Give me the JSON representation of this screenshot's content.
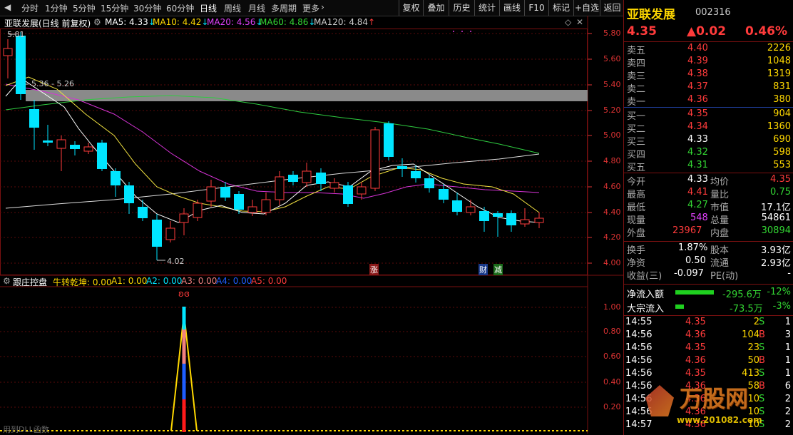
{
  "toolbar": {
    "periods": [
      "分时",
      "1分钟",
      "5分钟",
      "15分钟",
      "30分钟",
      "60分钟",
      "日线",
      "周线",
      "月线",
      "多周期",
      "更多"
    ],
    "buttons": [
      "复权",
      "叠加",
      "历史",
      "统计",
      "画线",
      "F10",
      "标记",
      "+自选",
      "返回"
    ]
  },
  "chart_header": {
    "title": "亚联发展(日线 前复权)",
    "ma5": "MA5: 4.33",
    "ma10": "MA10: 4.42",
    "ma20": "MA20: 4.56",
    "ma60": "MA60: 4.86",
    "ma120": "MA120: 4.84"
  },
  "price_axis": [
    "5.80",
    "5.60",
    "5.40",
    "5.20",
    "5.00",
    "4.80",
    "4.60",
    "4.40",
    "4.20",
    "4.00"
  ],
  "price_labels": {
    "high": "5.81",
    "low": "4.02",
    "range": "5.36 - 5.26"
  },
  "chart_marks": {
    "zhang": "涨",
    "cai": "财",
    "jian": "减"
  },
  "indicator": {
    "name": "跟庄控盘",
    "label_main": "牛转乾坤: 0.00",
    "a1": "A1: 0.00",
    "a2": "A2: 0.00",
    "a3": "A3: 0.00",
    "a4": "A4: 0.00",
    "a5": "A5: 0.00",
    "axis": [
      "1.00",
      "0.80",
      "0.60",
      "0.40",
      "0.20"
    ],
    "footer": "用到DLL函数"
  },
  "stock": {
    "name": "亚联发展",
    "code": "002316",
    "price": "4.35",
    "change": "▲0.02",
    "pct": "0.46%"
  },
  "asks": [
    {
      "label": "卖五",
      "price": "4.40",
      "vol": "2226"
    },
    {
      "label": "卖四",
      "price": "4.39",
      "vol": "1048"
    },
    {
      "label": "卖三",
      "price": "4.38",
      "vol": "1319"
    },
    {
      "label": "卖二",
      "price": "4.37",
      "vol": "831"
    },
    {
      "label": "卖一",
      "price": "4.36",
      "vol": "380"
    }
  ],
  "bids": [
    {
      "label": "买一",
      "price": "4.35",
      "vol": "904"
    },
    {
      "label": "买二",
      "price": "4.34",
      "vol": "1360"
    },
    {
      "label": "买三",
      "price": "4.33",
      "vol": "690"
    },
    {
      "label": "买四",
      "price": "4.32",
      "vol": "598"
    },
    {
      "label": "买五",
      "price": "4.31",
      "vol": "553"
    }
  ],
  "stats": [
    {
      "l1": "今开",
      "v1": "4.33",
      "l2": "均价",
      "v2": "4.35"
    },
    {
      "l1": "最高",
      "v1": "4.41",
      "l2": "量比",
      "v2": "0.75"
    },
    {
      "l1": "最低",
      "v1": "4.27",
      "l2": "市值",
      "v2": "17.1亿"
    },
    {
      "l1": "现量",
      "v1": "548",
      "l2": "总量",
      "v2": "54861"
    },
    {
      "l1": "外盘",
      "v1": "23967",
      "l2": "内盘",
      "v2": "30894"
    }
  ],
  "stats2": [
    {
      "l1": "换手",
      "v1": "1.87%",
      "l2": "股本",
      "v2": "3.93亿"
    },
    {
      "l1": "净资",
      "v1": "0.50",
      "l2": "流通",
      "v2": "2.93亿"
    },
    {
      "l1": "收益(三)",
      "v1": "-0.097",
      "l2": "PE(动)",
      "v2": "-"
    }
  ],
  "flows": [
    {
      "label": "净流入额",
      "value": "-295.6万",
      "pct": "-12%",
      "bar": 0.8
    },
    {
      "label": "大宗流入",
      "value": "-73.5万",
      "pct": "-3%",
      "bar": 0.15
    }
  ],
  "ticks": [
    {
      "time": "14:55",
      "price": "4.35",
      "vol": "2",
      "side": "S",
      "n": "1"
    },
    {
      "time": "14:56",
      "price": "4.36",
      "vol": "104",
      "side": "B",
      "n": "3"
    },
    {
      "time": "14:56",
      "price": "4.35",
      "vol": "23",
      "side": "S",
      "n": "1"
    },
    {
      "time": "14:56",
      "price": "4.36",
      "vol": "50",
      "side": "B",
      "n": "1"
    },
    {
      "time": "14:56",
      "price": "4.35",
      "vol": "413",
      "side": "S",
      "n": "1"
    },
    {
      "time": "14:56",
      "price": "4.36",
      "vol": "58",
      "side": "B",
      "n": "6"
    },
    {
      "time": "14:56",
      "price": "4.36",
      "vol": "10",
      "side": "S",
      "n": "2"
    },
    {
      "time": "14:56",
      "price": "4.36",
      "vol": "10",
      "side": "S",
      "n": "2"
    },
    {
      "time": "14:57",
      "price": "4.36",
      "vol": "10",
      "side": "S",
      "n": "2"
    }
  ],
  "watermark": {
    "brand": "万股网",
    "url": "www.201082.com"
  }
}
